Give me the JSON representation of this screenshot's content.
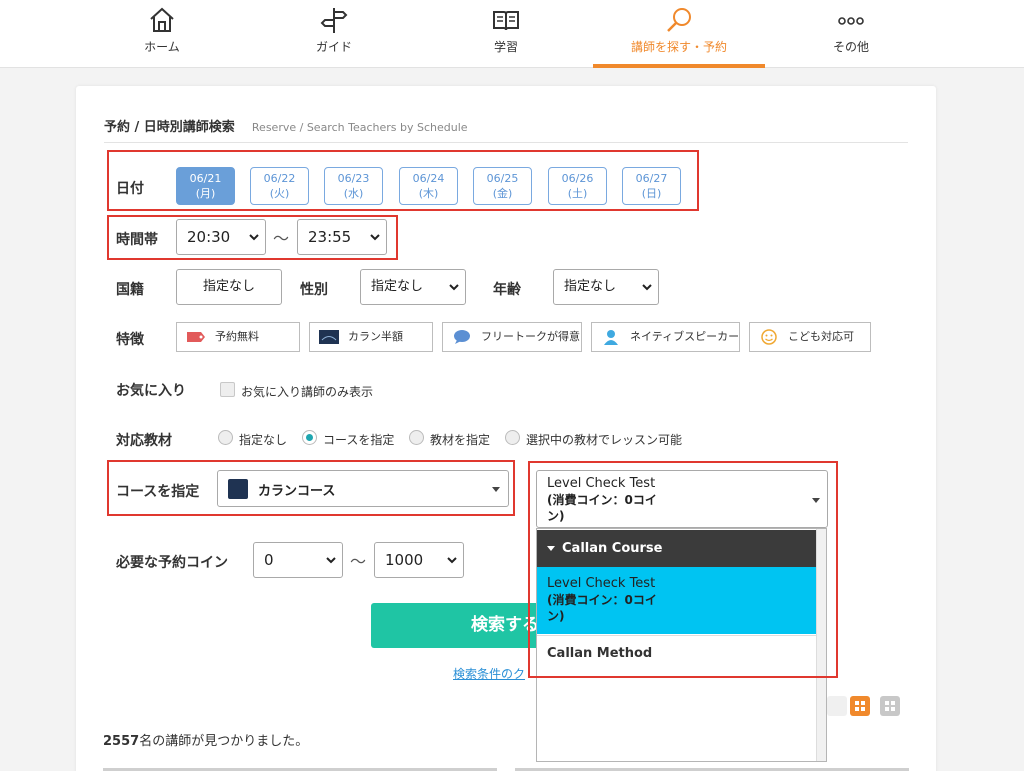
{
  "nav": {
    "items": [
      {
        "label": "ホーム",
        "icon": "home-icon"
      },
      {
        "label": "ガイド",
        "icon": "signpost-icon"
      },
      {
        "label": "学習",
        "icon": "book-icon"
      },
      {
        "label": "講師を探す・予約",
        "icon": "search-icon",
        "active": true
      },
      {
        "label": "その他",
        "icon": "more-icon"
      }
    ],
    "accent_color": "#f0892c"
  },
  "page": {
    "title": "予約 / 日時別講師検索",
    "subtitle": "Reserve / Search Teachers by Schedule"
  },
  "date": {
    "label": "日付",
    "options": [
      {
        "date": "06/21",
        "day": "(月)",
        "selected": true
      },
      {
        "date": "06/22",
        "day": "(火)"
      },
      {
        "date": "06/23",
        "day": "(水)"
      },
      {
        "date": "06/24",
        "day": "(木)"
      },
      {
        "date": "06/25",
        "day": "(金)"
      },
      {
        "date": "06/26",
        "day": "(土)"
      },
      {
        "date": "06/27",
        "day": "(日)"
      }
    ]
  },
  "time": {
    "label": "時間帯",
    "from": "20:30",
    "tilde": "〜",
    "to": "23:55"
  },
  "filters": {
    "nationality_label": "国籍",
    "nationality_value": "指定なし",
    "gender_label": "性別",
    "gender_value": "指定なし",
    "age_label": "年齢",
    "age_value": "指定なし"
  },
  "features": {
    "label": "特徴",
    "items": [
      {
        "label": "予約無料",
        "icon": "tag-icon"
      },
      {
        "label": "カラン半額",
        "icon": "callan-logo-icon"
      },
      {
        "label": "フリートークが得意",
        "icon": "chat-bubble-icon"
      },
      {
        "label": "ネイティブスピーカー",
        "icon": "person-icon"
      },
      {
        "label": "こども対応可",
        "icon": "smiley-icon"
      }
    ]
  },
  "favorites": {
    "label": "お気に入り",
    "checkbox_label": "お気に入り講師のみ表示"
  },
  "material": {
    "label": "対応教材",
    "options": [
      {
        "label": "指定なし"
      },
      {
        "label": "コースを指定",
        "checked": true
      },
      {
        "label": "教材を指定"
      },
      {
        "label": "選択中の教材でレッスン可能"
      }
    ]
  },
  "course": {
    "label": "コースを指定",
    "value": "カランコース"
  },
  "lesson_select": {
    "line1": "Level Check Test",
    "line2": "(消費コイン：0コイ",
    "line3": "ン)"
  },
  "dropdown": {
    "group_label": "Callan Course",
    "highlighted": {
      "line1": "Level Check Test",
      "line2": "(消費コイン：0コイ",
      "line3": "ン)"
    },
    "option2": "Callan Method",
    "highlight_color": "#00c4f2"
  },
  "coins": {
    "label": "必要な予約コイン",
    "from": "0",
    "tilde": "〜",
    "to": "1000"
  },
  "search_button": "検索する",
  "clear_link": "検索条件のク",
  "results": {
    "count": "2557",
    "suffix": "名の講師が見つかりました。"
  },
  "highlight_color": "#e0382f",
  "search_button_color": "#1fc5a4"
}
